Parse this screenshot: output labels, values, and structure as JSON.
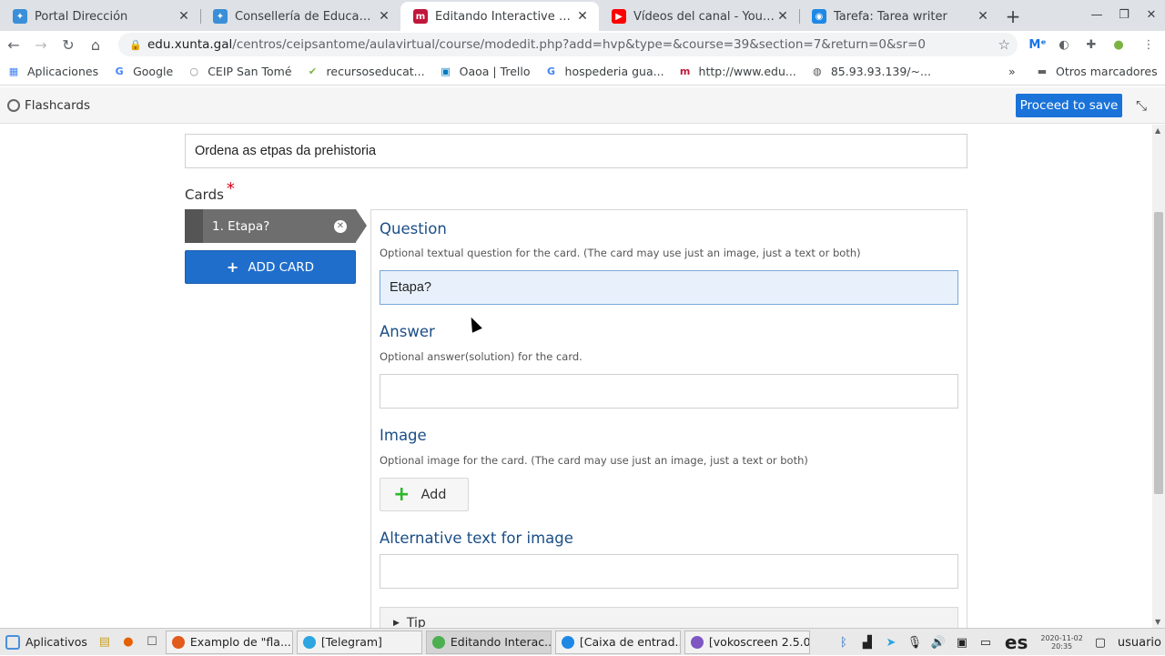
{
  "browser": {
    "tabs": [
      {
        "title": "Portal Dirección",
        "color": "#3a8fd8"
      },
      {
        "title": "Consellería de Educación,",
        "color": "#3a8fd8"
      },
      {
        "title": "Editando Interactive Conte",
        "color": "#c0173a",
        "active": true
      },
      {
        "title": "Vídeos del canal - YouTube",
        "color": "#ff0000"
      },
      {
        "title": "Tarefa: Tarea writer",
        "color": "#1e88e5"
      }
    ],
    "url_host": "edu.xunta.gal",
    "url_path": "/centros/ceipsantome/aulavirtual/course/modedit.php?add=hvp&type=&course=39&section=7&return=0&sr=0",
    "bookmarks": [
      {
        "label": "Aplicaciones",
        "icon": "apps-grid-icon"
      },
      {
        "label": "Google",
        "icon": "google-icon"
      },
      {
        "label": "CEIP San Tomé",
        "icon": "globe-icon"
      },
      {
        "label": "recursoseducat...",
        "icon": "check-icon"
      },
      {
        "label": "Oaoa | Trello",
        "icon": "trello-icon"
      },
      {
        "label": "hospederia gua...",
        "icon": "google-icon"
      },
      {
        "label": "http://www.edu...",
        "icon": "moodle-icon"
      },
      {
        "label": "85.93.93.139/~...",
        "icon": "globe-icon"
      }
    ],
    "bookmarks_more": "»",
    "other_bookmarks": "Otros marcadores"
  },
  "h5p": {
    "content_type": "Flashcards",
    "save_label": "Proceed to save"
  },
  "form": {
    "title_value": "Ordena as etpas da prehistoria",
    "cards_label": "Cards",
    "required_mark": "*",
    "cards": [
      {
        "label": "1. Etapa?"
      }
    ],
    "add_card_label": "ADD CARD",
    "question": {
      "heading": "Question",
      "description": "Optional textual question for the card. (The card may use just an image, just a text or both)",
      "value": "Etapa?"
    },
    "answer": {
      "heading": "Answer",
      "description": "Optional answer(solution) for the card.",
      "value": ""
    },
    "image": {
      "heading": "Image",
      "description": "Optional image for the card. (The card may use just an image, just a text or both)",
      "add_label": "Add"
    },
    "alt_text": {
      "heading": "Alternative text for image",
      "value": ""
    },
    "tip_label": "Tip"
  },
  "taskbar": {
    "start_label": "Aplicativos",
    "tasks": [
      {
        "label": "Exampl​o de \"fla...",
        "color": "#e25a1c"
      },
      {
        "label": "[Telegram]",
        "color": "#2ca5e0"
      },
      {
        "label": "Editando Interac...",
        "color": "#4caf50",
        "active": true
      },
      {
        "label": "[Caixa de entrad...",
        "color": "#1e88e5"
      },
      {
        "label": "[vokoscreen 2.5.0]",
        "color": "#7e57c2"
      }
    ],
    "keyboard": "es",
    "clock_date": "2020-11-02",
    "clock_time": "20:35",
    "user": "usuario"
  }
}
